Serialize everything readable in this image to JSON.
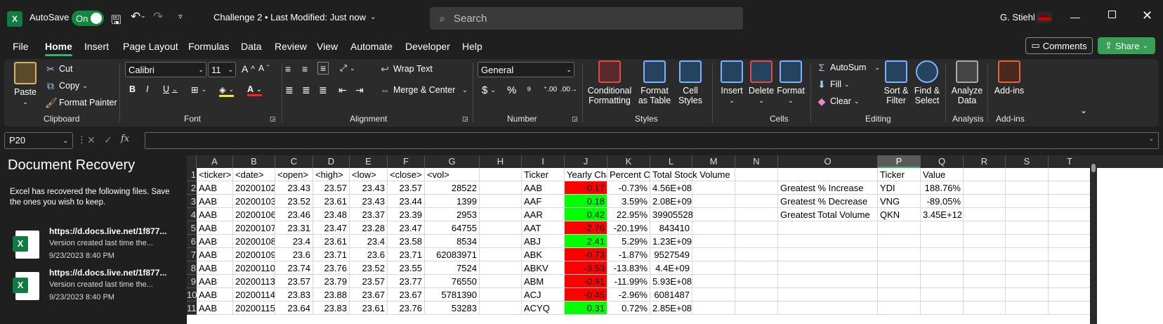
{
  "title": {
    "autosave_label": "AutoSave",
    "autosave_state": "On",
    "doc_title": "Challenge 2 • Last Modified: Just now",
    "search_placeholder": "Search",
    "user": "G. Stiehl"
  },
  "menu": [
    "File",
    "Home",
    "Insert",
    "Page Layout",
    "Formulas",
    "Data",
    "Review",
    "View",
    "Automate",
    "Developer",
    "Help"
  ],
  "actions": {
    "comments": "Comments",
    "share": "Share"
  },
  "ribbon": {
    "clipboard": {
      "paste": "Paste",
      "cut": "Cut",
      "copy": "Copy",
      "format_painter": "Format Painter",
      "label": "Clipboard"
    },
    "font": {
      "name": "Calibri",
      "size": "11",
      "label": "Font"
    },
    "alignment": {
      "wrap": "Wrap Text",
      "merge": "Merge & Center",
      "label": "Alignment"
    },
    "number": {
      "format": "General",
      "label": "Number"
    },
    "styles": {
      "cond": "Conditional Formatting",
      "table": "Format as Table",
      "cell": "Cell Styles",
      "label": "Styles"
    },
    "cells": {
      "insert": "Insert",
      "delete": "Delete",
      "format": "Format",
      "label": "Cells"
    },
    "editing": {
      "autosum": "AutoSum",
      "fill": "Fill",
      "clear": "Clear",
      "sort": "Sort & Filter",
      "find": "Find & Select",
      "label": "Editing"
    },
    "analysis": {
      "analyze": "Analyze Data",
      "label": "Analysis"
    },
    "addins": {
      "addins": "Add-ins",
      "label": "Add-ins"
    }
  },
  "formula_bar": {
    "name_box": "P20",
    "value": ""
  },
  "recovery": {
    "title": "Document Recovery",
    "desc": "Excel has recovered the following files.  Save the ones you wish to keep.",
    "files": [
      {
        "name": "https://d.docs.live.net/1f877...",
        "sub": "Version created last time the...",
        "date": "9/23/2023 8:40 PM"
      },
      {
        "name": "https://d.docs.live.net/1f877...",
        "sub": "Version created last time the...",
        "date": "9/23/2023 8:40 PM"
      }
    ]
  },
  "columns": [
    "A",
    "B",
    "C",
    "D",
    "E",
    "F",
    "G",
    "H",
    "I",
    "J",
    "K",
    "L",
    "M",
    "N",
    "O",
    "P",
    "Q",
    "R",
    "S",
    "T"
  ],
  "selected_column": "P",
  "rows": [
    {
      "n": "1",
      "A": "<ticker>",
      "B": "<date>",
      "C": "<open>",
      "D": "<high>",
      "E": "<low>",
      "F": "<close>",
      "G": "<vol>",
      "I": "Ticker",
      "J": "Yearly Cha",
      "K": "Percent C",
      "L": "Total Stock Volume",
      "P": "Ticker",
      "Q": "Value"
    },
    {
      "n": "2",
      "A": "AAB",
      "B": "20200102",
      "C": "23.43",
      "D": "23.57",
      "E": "23.43",
      "F": "23.57",
      "G": "28522",
      "I": "AAB",
      "J": "-0.17",
      "K": "-0.73%",
      "L": "4.56E+08",
      "O": "Greatest % Increase",
      "P": "YDI",
      "Q": "188.76%"
    },
    {
      "n": "3",
      "A": "AAB",
      "B": "20200103",
      "C": "23.52",
      "D": "23.61",
      "E": "23.43",
      "F": "23.44",
      "G": "1399",
      "I": "AAF",
      "J": "0.18",
      "K": "3.59%",
      "L": "2.08E+09",
      "O": "Greatest % Decrease",
      "P": "VNG",
      "Q": "-89.05%"
    },
    {
      "n": "4",
      "A": "AAB",
      "B": "20200106",
      "C": "23.46",
      "D": "23.48",
      "E": "23.37",
      "F": "23.39",
      "G": "2953",
      "I": "AAR",
      "J": "0.42",
      "K": "22.95%",
      "L": "39905528",
      "O": "Greatest Total Volume",
      "P": "QKN",
      "Q": "3.45E+12"
    },
    {
      "n": "5",
      "A": "AAB",
      "B": "20200107",
      "C": "23.31",
      "D": "23.47",
      "E": "23.28",
      "F": "23.47",
      "G": "64755",
      "I": "AAT",
      "J": "-2.76",
      "K": "-20.19%",
      "L": "843410"
    },
    {
      "n": "6",
      "A": "AAB",
      "B": "20200108",
      "C": "23.4",
      "D": "23.61",
      "E": "23.4",
      "F": "23.58",
      "G": "8534",
      "I": "ABJ",
      "J": "2.41",
      "K": "5.29%",
      "L": "1.23E+09"
    },
    {
      "n": "7",
      "A": "AAB",
      "B": "20200109",
      "C": "23.6",
      "D": "23.71",
      "E": "23.6",
      "F": "23.71",
      "G": "62083971",
      "I": "ABK",
      "J": "-0.73",
      "K": "-1.87%",
      "L": "9527549"
    },
    {
      "n": "8",
      "A": "AAB",
      "B": "20200110",
      "C": "23.74",
      "D": "23.76",
      "E": "23.52",
      "F": "23.55",
      "G": "7524",
      "I": "ABKV",
      "J": "-3.53",
      "K": "-13.83%",
      "L": "4.4E+09"
    },
    {
      "n": "9",
      "A": "AAB",
      "B": "20200113",
      "C": "23.57",
      "D": "23.79",
      "E": "23.57",
      "F": "23.77",
      "G": "76550",
      "I": "ABM",
      "J": "-0.91",
      "K": "-11.99%",
      "L": "5.93E+08"
    },
    {
      "n": "10",
      "A": "AAB",
      "B": "20200114",
      "C": "23.83",
      "D": "23.88",
      "E": "23.67",
      "F": "23.67",
      "G": "5781390",
      "I": "ACJ",
      "J": "-0.45",
      "K": "-2.96%",
      "L": "6081487"
    },
    {
      "n": "11",
      "A": "AAB",
      "B": "20200115",
      "C": "23.64",
      "D": "23.83",
      "E": "23.61",
      "F": "23.76",
      "G": "53283",
      "I": "ACYQ",
      "J": "0.31",
      "K": "0.72%",
      "L": "2.85E+08"
    }
  ],
  "colors": {
    "accent": "#38b26b",
    "share": "#38a055",
    "positive": "#00ff00",
    "negative": "#ff0000"
  }
}
